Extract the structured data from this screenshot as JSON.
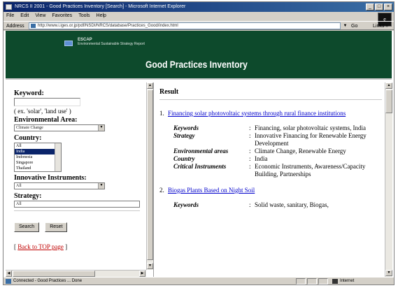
{
  "window": {
    "title": "NRCS II 2001 - Good Practices Inventory [Search] - Microsoft Internet Explorer",
    "controls": [
      "_",
      "□",
      "×"
    ]
  },
  "menubar": {
    "items": [
      "File",
      "Edit",
      "View",
      "Favorites",
      "Tools",
      "Help"
    ]
  },
  "addressbar": {
    "label": "Address",
    "url": "http://www.i.iges.or.jp/pdf/NSDI/NRCS/database/Practices_Good/index.html",
    "go_label": "Go",
    "links_label": "Links »"
  },
  "banner": {
    "org_name": "ESCAP",
    "org_subtitle": "Environmental Sustainable Strategy Report",
    "title": "Good Practices Inventory"
  },
  "search_form": {
    "keyword_label": "Keyword:",
    "keyword_value": "",
    "keyword_hint": "( ex. 'solar', 'land use' )",
    "env_area_label": "Environmental Area:",
    "env_area_value": "Climate Change",
    "country_label": "Country:",
    "country_options": [
      "All",
      "India",
      "Indonesia",
      "Singapore",
      "Thailand"
    ],
    "country_selected_index": 1,
    "instruments_label": "Innovative Instruments:",
    "instruments_value": "All",
    "strategy_label": "Strategy:",
    "strategy_value": "All",
    "search_button": "Search",
    "reset_button": "Reset",
    "back_prefix": "[",
    "back_link": "Back to TOP page",
    "back_suffix": "]"
  },
  "results": {
    "heading": "Result",
    "items": [
      {
        "number": "1.",
        "title": "Financing solar photovoltaic systems through rural finance institutions",
        "fields": [
          {
            "key": "Keywords",
            "value": "Financing, solar photovoltaic systems, India"
          },
          {
            "key": "Strategy",
            "value": "Innovative Financing for Renewable Energy Development"
          },
          {
            "key": "Environmental areas",
            "value": "Climate Change, Renewable Energy"
          },
          {
            "key": "Country",
            "value": "India"
          },
          {
            "key": "Critical Instruments",
            "value": "Economic Instruments, Awareness/Capacity Building, Partnerships"
          }
        ]
      },
      {
        "number": "2.",
        "title": "Biogas Plants Based on Night Soil",
        "fields": [
          {
            "key": "Keywords",
            "value": "Solid waste, sanitary, Biogas,"
          }
        ]
      }
    ]
  },
  "statusbar": {
    "text": "Connected - Good Practices ... Done",
    "zone": "Internet"
  }
}
